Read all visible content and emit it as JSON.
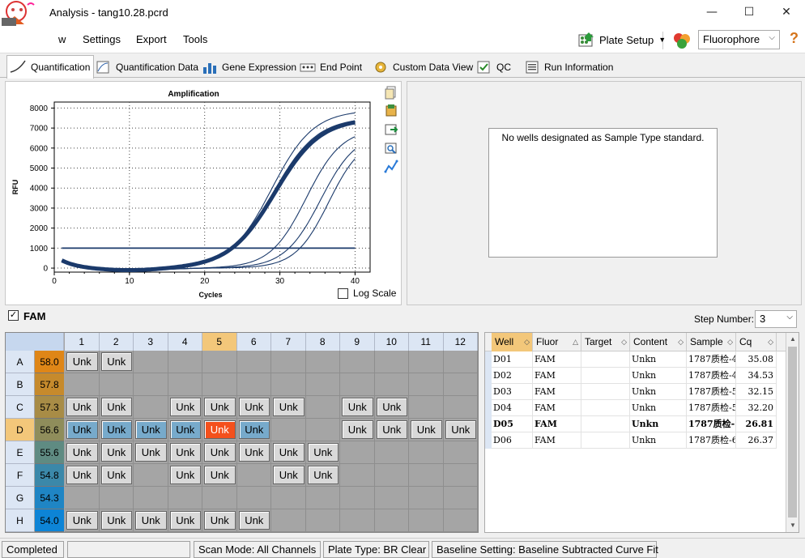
{
  "window": {
    "title": "Analysis - tang10.28.pcrd",
    "minimize": "—",
    "maximize": "☐",
    "close": "✕"
  },
  "menu": {
    "view": "w",
    "settings": "Settings",
    "export": "Export",
    "tools": "Tools"
  },
  "toolbar": {
    "plate_setup": "Plate Setup",
    "fluorophore": "Fluorophore",
    "help": "?"
  },
  "tabs": [
    {
      "label": "Quantification",
      "active": true
    },
    {
      "label": "Quantification Data"
    },
    {
      "label": "Gene Expression"
    },
    {
      "label": "End Point"
    },
    {
      "label": "Custom Data View"
    },
    {
      "label": "QC"
    },
    {
      "label": "Run Information"
    }
  ],
  "amplification": {
    "log_scale_label": "Log Scale",
    "log_scale_checked": false
  },
  "chart_data": {
    "type": "line",
    "title": "Amplification",
    "xlabel": "Cycles",
    "ylabel": "RFU",
    "xlim": [
      0,
      42
    ],
    "ylim": [
      -200,
      8300
    ],
    "xticks": [
      "0",
      "10",
      "20",
      "30",
      "40"
    ],
    "yticks": [
      "0",
      "1000",
      "2000",
      "3000",
      "4000",
      "5000",
      "6000",
      "7000",
      "8000"
    ],
    "grid": true,
    "threshold": 1000,
    "curve_color": "#1b3a6b",
    "series": [
      {
        "params": [
          7900,
          28.9,
          0.36
        ],
        "highlight": false
      },
      {
        "params": [
          7550,
          29.1,
          0.34
        ],
        "highlight": false
      },
      {
        "params": [
          7500,
          29.3,
          0.33
        ],
        "highlight": true
      },
      {
        "params": [
          7000,
          33.5,
          0.42
        ],
        "highlight": false
      },
      {
        "params": [
          6800,
          35.4,
          0.42
        ],
        "highlight": false
      },
      {
        "params": [
          6600,
          36.5,
          0.45
        ],
        "highlight": false
      }
    ]
  },
  "standard_curve": {
    "message": "No wells designated as Sample Type standard."
  },
  "fluor_bar": {
    "checked": true,
    "label": "FAM",
    "step_label": "Step Number:",
    "step_value": "3"
  },
  "plate": {
    "columns": [
      "1",
      "2",
      "3",
      "4",
      "5",
      "6",
      "7",
      "8",
      "9",
      "10",
      "11",
      "12"
    ],
    "selected_col": 4,
    "selected_row": 3,
    "rows": [
      {
        "label": "A",
        "temp": "58.0",
        "temp_color": "#df8617",
        "wells": [
          "Unk",
          "Unk",
          "",
          "",
          "",
          "",
          "",
          "",
          "",
          "",
          "",
          ""
        ]
      },
      {
        "label": "B",
        "temp": "57.8",
        "temp_color": "#c68a2c",
        "wells": [
          "",
          "",
          "",
          "",
          "",
          "",
          "",
          "",
          "",
          "",
          "",
          ""
        ]
      },
      {
        "label": "C",
        "temp": "57.3",
        "temp_color": "#a88c46",
        "wells": [
          "Unk",
          "Unk",
          "",
          "Unk",
          "Unk",
          "Unk",
          "Unk",
          "",
          "Unk",
          "Unk",
          "",
          ""
        ]
      },
      {
        "label": "D",
        "temp": "56.6",
        "temp_color": "#8f8d5b",
        "wells": [
          "Unk",
          "Unk",
          "Unk",
          "Unk",
          "Unk",
          "Unk",
          "",
          "",
          "Unk",
          "Unk",
          "Unk",
          "Unk"
        ]
      },
      {
        "label": "E",
        "temp": "55.6",
        "temp_color": "#5f8b82",
        "wells": [
          "Unk",
          "Unk",
          "Unk",
          "Unk",
          "Unk",
          "Unk",
          "Unk",
          "Unk",
          "",
          "",
          "",
          ""
        ]
      },
      {
        "label": "F",
        "temp": "54.8",
        "temp_color": "#3b88a9",
        "wells": [
          "Unk",
          "Unk",
          "",
          "Unk",
          "Unk",
          "",
          "Unk",
          "Unk",
          "",
          "",
          "",
          ""
        ]
      },
      {
        "label": "G",
        "temp": "54.3",
        "temp_color": "#1f85c4",
        "wells": [
          "",
          "",
          "",
          "",
          "",
          "",
          "",
          "",
          "",
          "",
          "",
          ""
        ]
      },
      {
        "label": "H",
        "temp": "54.0",
        "temp_color": "#0d84d6",
        "wells": [
          "Unk",
          "Unk",
          "Unk",
          "Unk",
          "Unk",
          "Unk",
          "",
          "",
          "",
          "",
          "",
          ""
        ]
      }
    ]
  },
  "table": {
    "headers": [
      "Well",
      "Fluor",
      "Target",
      "Content",
      "Sample",
      "Cq"
    ],
    "rows": [
      {
        "well": "D01",
        "fluor": "FAM",
        "target": "",
        "content": "Unkn",
        "sample": "1787质检-4",
        "cq": "35.08",
        "bold": false
      },
      {
        "well": "D02",
        "fluor": "FAM",
        "target": "",
        "content": "Unkn",
        "sample": "1787质检-4",
        "cq": "34.53",
        "bold": false
      },
      {
        "well": "D03",
        "fluor": "FAM",
        "target": "",
        "content": "Unkn",
        "sample": "1787质检-5",
        "cq": "32.15",
        "bold": false
      },
      {
        "well": "D04",
        "fluor": "FAM",
        "target": "",
        "content": "Unkn",
        "sample": "1787质检-5",
        "cq": "32.20",
        "bold": false
      },
      {
        "well": "D05",
        "fluor": "FAM",
        "target": "",
        "content": "Unkn",
        "sample": "1787质检-",
        "cq": "26.81",
        "bold": true
      },
      {
        "well": "D06",
        "fluor": "FAM",
        "target": "",
        "content": "Unkn",
        "sample": "1787质检-6",
        "cq": "26.37",
        "bold": false
      }
    ]
  },
  "status": {
    "state": "Completed",
    "scan_mode": "Scan Mode: All Channels",
    "plate_type": "Plate Type: BR Clear",
    "baseline": "Baseline Setting: Baseline Subtracted Curve Fit"
  }
}
